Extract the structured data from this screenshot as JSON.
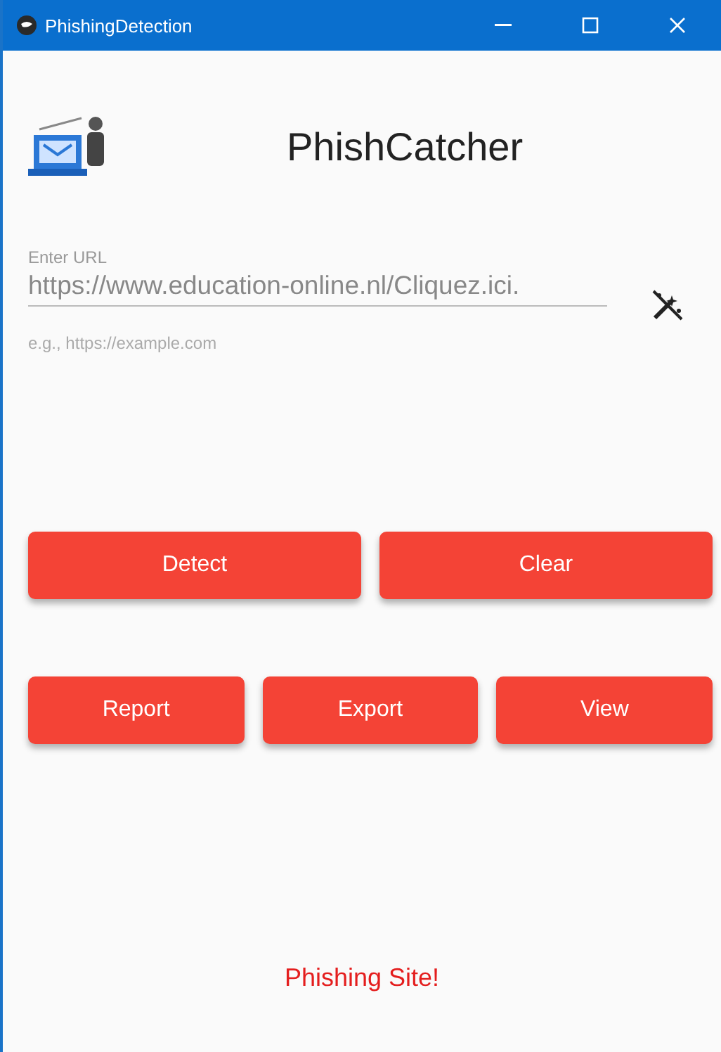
{
  "window": {
    "title": "PhishingDetection"
  },
  "header": {
    "title": "PhishCatcher"
  },
  "url_field": {
    "label": "Enter URL",
    "value": "https://www.education-online.nl/Cliquez.ici.",
    "helper": "e.g., https://example.com"
  },
  "primary_buttons": [
    "Detect",
    "Clear"
  ],
  "secondary_buttons": [
    "Report",
    "Export",
    "View"
  ],
  "result": {
    "text": "Phishing Site!",
    "kind": "phishing"
  }
}
